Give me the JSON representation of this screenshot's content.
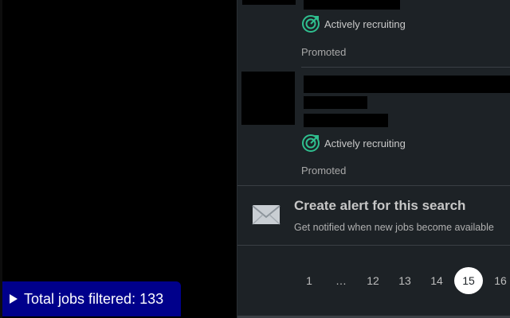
{
  "jobs": [
    {
      "recruiting_label": "Actively recruiting",
      "promoted_label": "Promoted"
    },
    {
      "recruiting_label": "Actively recruiting",
      "promoted_label": "Promoted"
    }
  ],
  "alert": {
    "title": "Create alert for this search",
    "subtitle": "Get notified when new jobs become available"
  },
  "pagination": {
    "pages": [
      "1",
      "…",
      "12",
      "13",
      "14",
      "15",
      "16"
    ],
    "current": "15"
  },
  "filter_badge": {
    "label": "Total jobs filtered: 133"
  },
  "colors": {
    "recruiting_icon": "#2fbf8f",
    "badge_background": "#00008b",
    "panel_background": "#1d2226"
  },
  "icons": {
    "recruiting": "target-icon",
    "alert": "envelope-icon",
    "badge": "triangle-right-icon"
  }
}
